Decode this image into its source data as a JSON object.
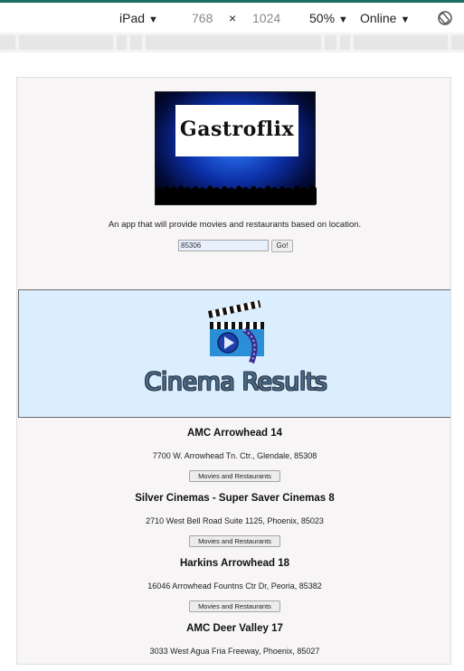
{
  "devtools": {
    "device": "iPad",
    "width": "768",
    "times": "×",
    "height": "1024",
    "zoom": "50%",
    "network": "Online",
    "caret": "▼"
  },
  "page": {
    "logo_text": "Gastroflix",
    "tagline": "An app that will provide movies and restaurants based on location.",
    "zip_value": "85306",
    "go_label": "Go!",
    "banner_title": "Cinema Results"
  },
  "cinemas": [
    {
      "name": "AMC Arrowhead 14",
      "address": "7700 W. Arrowhead Tn. Ctr., Glendale, 85308",
      "button": "Movies and Restaurants"
    },
    {
      "name": "Silver Cinemas - Super Saver Cinemas 8",
      "address": "2710 West Bell Road Suite 1125, Phoenix, 85023",
      "button": "Movies and Restaurants"
    },
    {
      "name": "Harkins Arrowhead 18",
      "address": "16046 Arrowhead Fountns Ctr Dr, Peoria, 85382",
      "button": "Movies and Restaurants"
    },
    {
      "name": "AMC Deer Valley 17",
      "address": "3033 West Agua Fria Freeway, Phoenix, 85027"
    }
  ]
}
